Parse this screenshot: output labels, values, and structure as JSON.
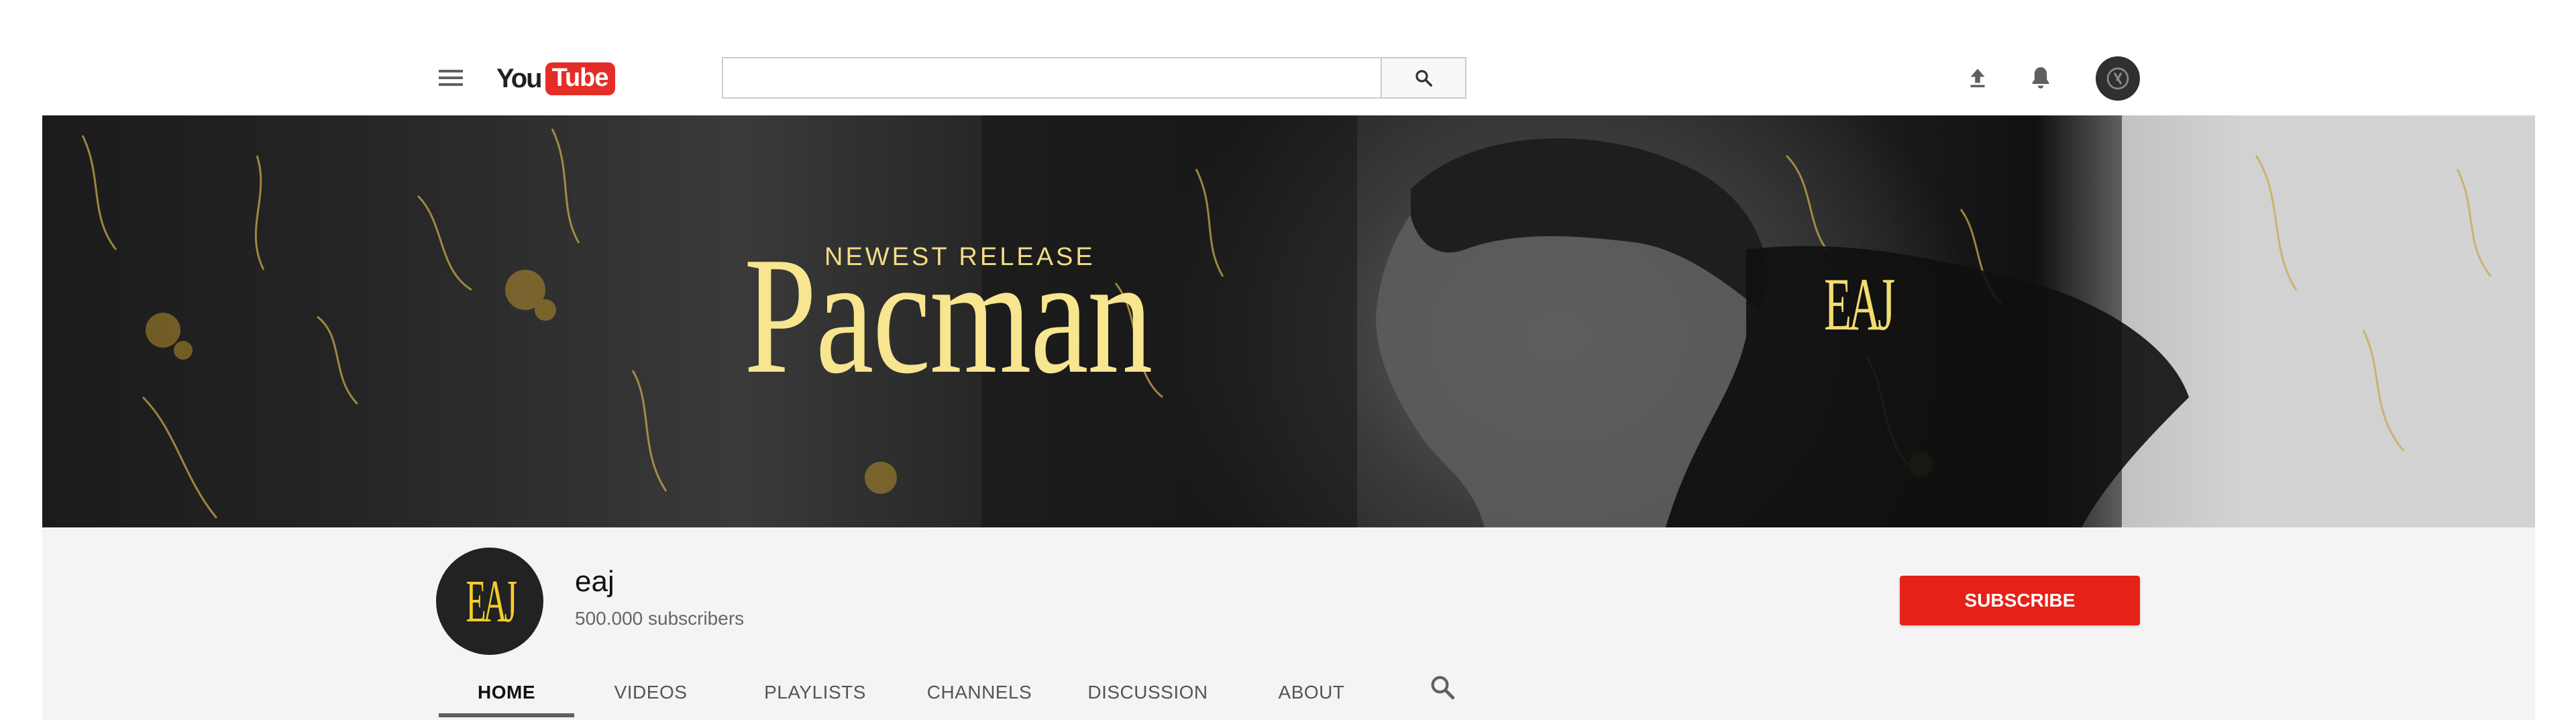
{
  "topbar": {
    "logo_you": "You",
    "logo_tube": "Tube",
    "search": {
      "value": "",
      "placeholder": ""
    },
    "icons": [
      "menu-icon",
      "search-icon",
      "upload-icon",
      "bell-icon",
      "avatar"
    ]
  },
  "banner": {
    "subtitle": "NEWEST RELEASE",
    "title": "Pacman",
    "brand": "EAJ"
  },
  "channel": {
    "avatar_text": "EAJ",
    "name": "eaj",
    "subscribers": "500.000 subscribers",
    "subscribe_label": "SUBSCRIBE"
  },
  "tabs": [
    {
      "label": "HOME",
      "active": true
    },
    {
      "label": "VIDEOS"
    },
    {
      "label": "PLAYLISTS"
    },
    {
      "label": "CHANNELS"
    },
    {
      "label": "DISCUSSION"
    },
    {
      "label": "ABOUT"
    }
  ],
  "colors": {
    "brand_red": "#e62117",
    "banner_gold": "#f7e58f",
    "header_bg": "#f4f4f4"
  }
}
